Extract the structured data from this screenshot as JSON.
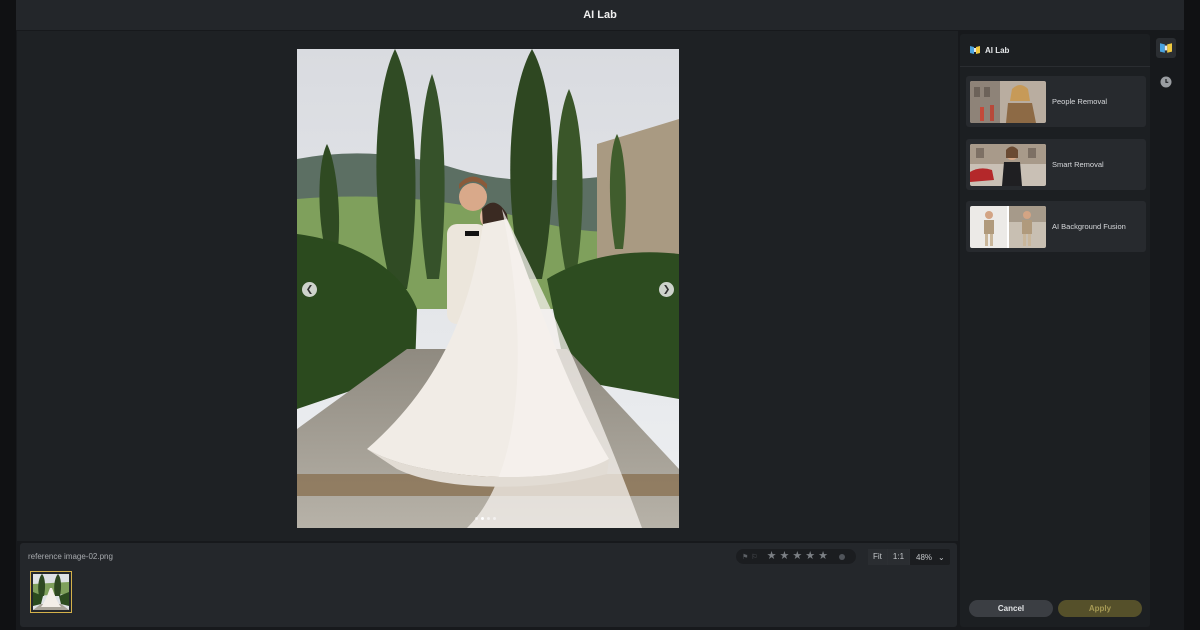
{
  "window": {
    "title": "AI Lab"
  },
  "viewer": {
    "prev_icon": "chevron-left-icon",
    "next_icon": "chevron-right-icon",
    "page_dots": 4,
    "active_dot": 1
  },
  "bottom": {
    "filename": "reference image-02.png",
    "rating": {
      "stars": 5,
      "filled": 0
    },
    "zoom": {
      "fit_label": "Fit",
      "one_to_one_label": "1:1",
      "percent": "48%"
    }
  },
  "panel": {
    "title": "AI Lab",
    "tools": [
      {
        "label": "People Removal"
      },
      {
        "label": "Smart Removal"
      },
      {
        "label": "AI Background Fusion"
      }
    ],
    "cancel_label": "Cancel",
    "apply_label": "Apply"
  },
  "colors": {
    "accent_gold": "#d4b14a",
    "apply_bg": "#55502a"
  }
}
